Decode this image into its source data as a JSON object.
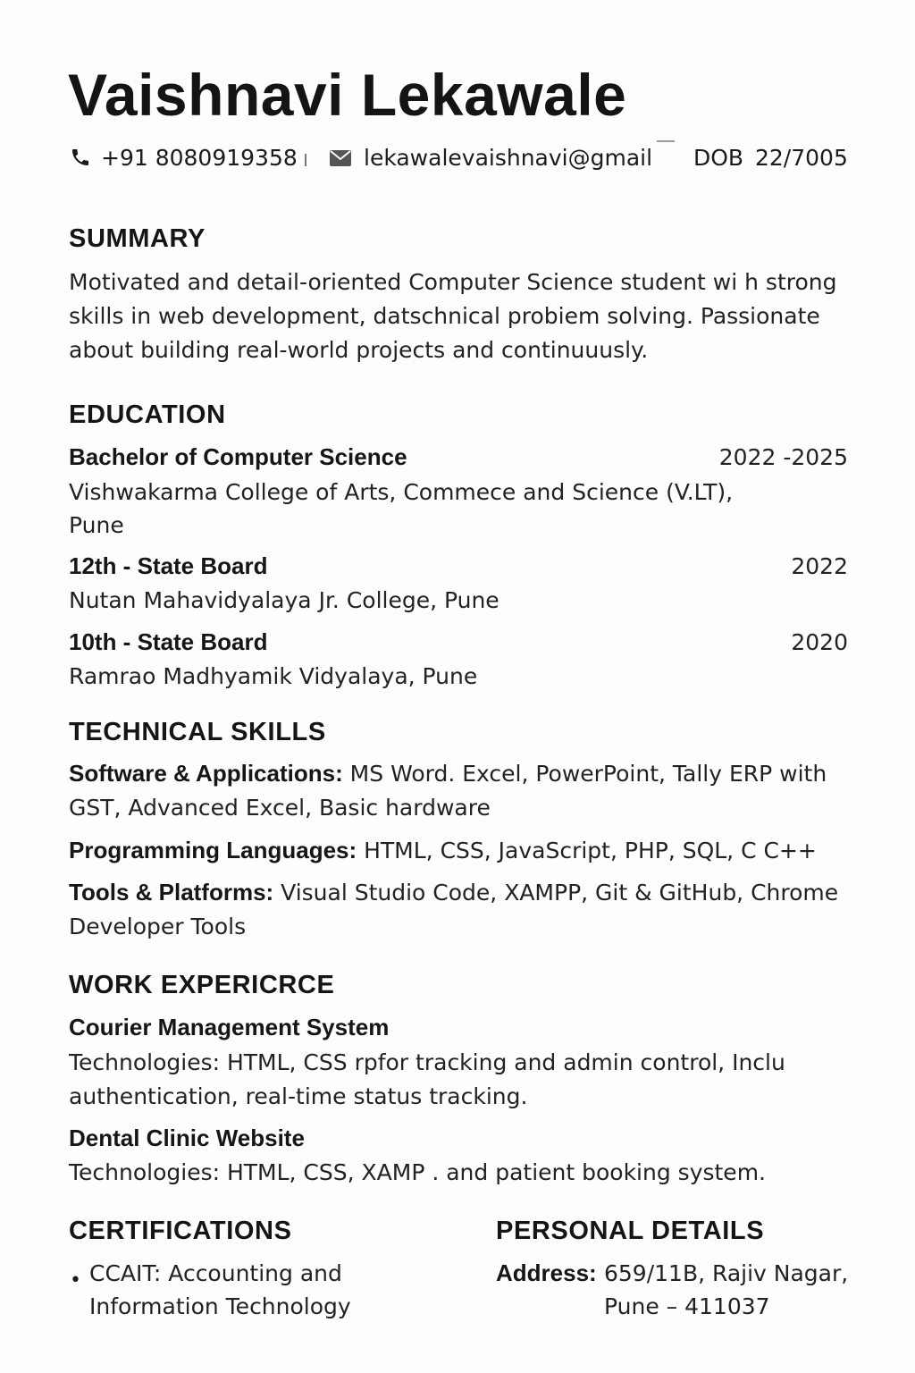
{
  "header": {
    "name": "Vaishnavi Lekawale",
    "phone": "+91 8080919358",
    "email": "lekawalevaishnavi@gmail",
    "dob_label": "DOB",
    "dob_value": "22/7005",
    "phone_icon": "phone-icon",
    "mail_icon": "mail-icon"
  },
  "summary": {
    "heading": "SUMMARY",
    "lines": [
      "Motivated and detail-oriented Computer  Science student wi h strong",
      "skills in web development, datschnical probiem solving. Passionate",
      "about building real-world projects and continuuusly."
    ]
  },
  "education": {
    "heading": "EDUCATION",
    "entries": [
      {
        "title": "Bachelor of Computer Science",
        "years": "2022 -2025",
        "lines": [
          "Vishwakarma College of Arts, Commece and Science (V.LT),",
          "Pune"
        ]
      },
      {
        "title": "12th - State Board",
        "years": "2022",
        "lines": [
          "Nutan Mahavidyalaya Jr. College, Pune"
        ]
      },
      {
        "title": "10th - State Board",
        "years": "2020",
        "lines": [
          "Ramrao Madhyamik Vidyalaya, Pune"
        ]
      }
    ]
  },
  "skills": {
    "heading": "TECHNICAL SKILLS",
    "items": [
      {
        "label": "Software & Applications:",
        "value_lines": [
          " MS Word. Excel, PowerPoint, Tally ERP with",
          "GST, Advanced Excel, Basic hardware"
        ]
      },
      {
        "label": "Programming Languages:",
        "value_lines": [
          " HTML, CSS, JavaScript, PHP, SQL, C C++"
        ]
      },
      {
        "label": "Tools & Platforms:",
        "value_lines": [
          " Visual Studio Code, XAMPP, Git & GitHub, Chrome",
          "Developer Tools"
        ]
      }
    ]
  },
  "experience": {
    "heading": "WORK EXPERICRCE",
    "projects": [
      {
        "title": "Courier Management System",
        "lines": [
          "Technologies: HTML, CSS rpfor tracking and admin control, Incluc",
          "authentication, real-time status tracking."
        ]
      },
      {
        "title": "Dental Clinic Website",
        "lines": [
          "Technologies: HTML, CSS, XAMP . and patient booking system."
        ]
      }
    ]
  },
  "certifications": {
    "heading": "CERTIFICATIONS",
    "items": [
      {
        "lines": [
          "CCAIT: Accounting and",
          "Information Technology"
        ]
      }
    ]
  },
  "personal": {
    "heading": "PERSONAL DETAILS",
    "address_label": "Address:",
    "address_lines": [
      "659/11B, Rajiv  Nagar,",
      "Pune – 411037"
    ]
  }
}
